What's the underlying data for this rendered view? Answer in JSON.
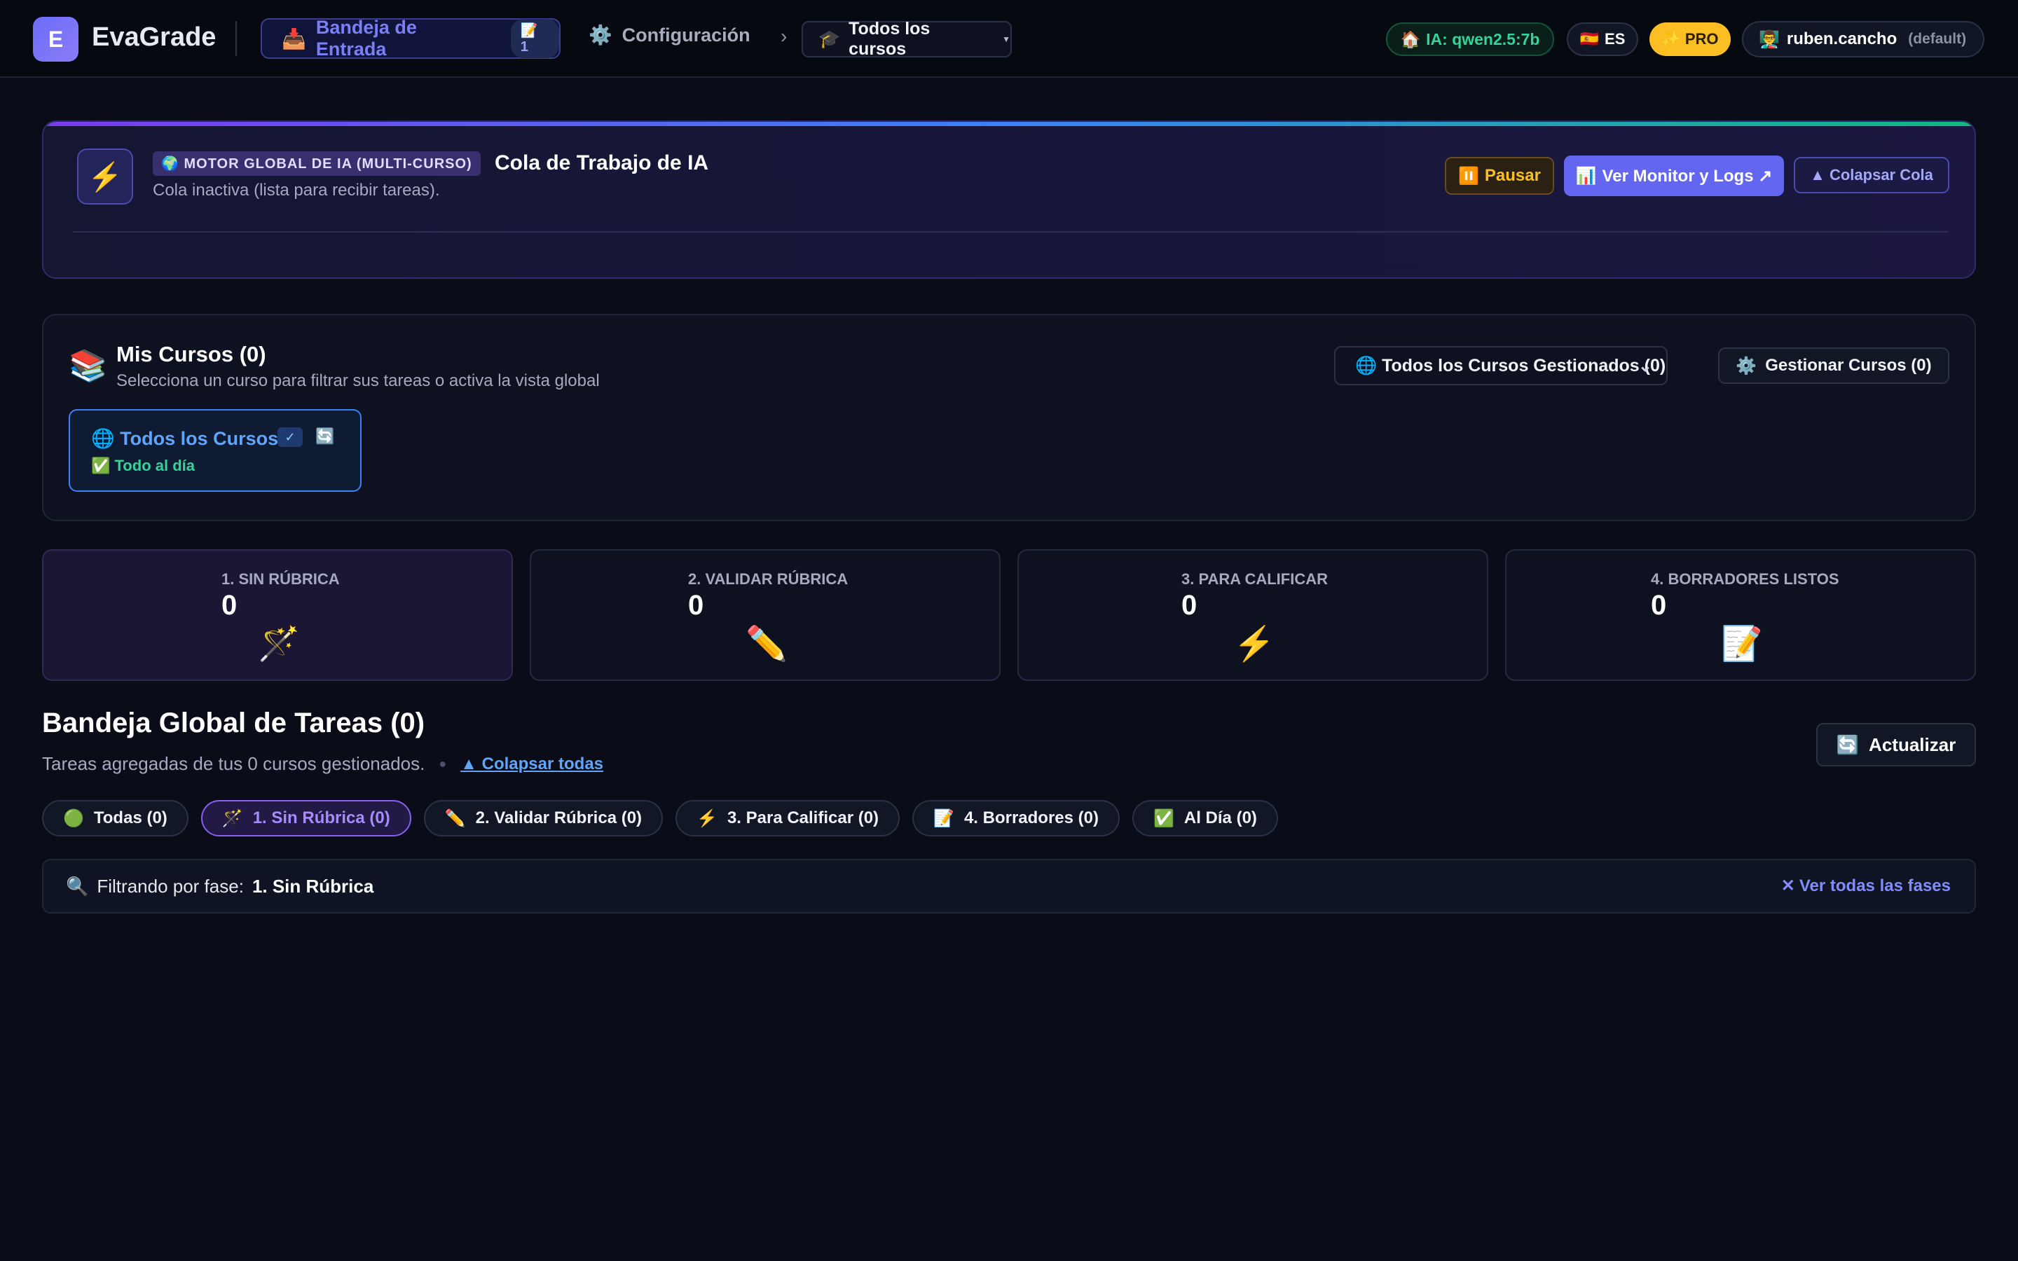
{
  "header": {
    "logo_letter": "E",
    "app_name": "EvaGrade",
    "inbox_label": "Bandeja de Entrada",
    "inbox_badge": "📝 1",
    "config_label": "Configuración",
    "course_dropdown": "Todos los cursos",
    "ai_status": "IA: qwen2.5:7b",
    "language": "ES",
    "plan": "PRO",
    "user_name": "ruben.cancho",
    "user_profile": "(default)"
  },
  "queue": {
    "engine_badge": "🌍 MOTOR GLOBAL DE IA (MULTI-CURSO)",
    "title": "Cola de Trabajo de IA",
    "subtitle": "Cola inactiva (lista para recibir tareas).",
    "pause_label": "Pausar",
    "monitor_label": "Ver Monitor y Logs ↗",
    "collapse_label": "▲ Colapsar Cola"
  },
  "courses": {
    "title": "Mis Cursos (0)",
    "subtitle": "Selecciona un curso para filtrar sus tareas o activa la vista global",
    "managed_select": "🌐 Todos los Cursos Gestionados (0)",
    "manage_label": "Gestionar Cursos (0)",
    "card_name": "🌐 Todos los Cursos",
    "card_check": "✓",
    "card_status": "✅ Todo al día"
  },
  "stats": [
    {
      "label": "1. SIN RÚBRICA",
      "value": "0",
      "emoji": "🪄"
    },
    {
      "label": "2. VALIDAR RÚBRICA",
      "value": "0",
      "emoji": "✏️"
    },
    {
      "label": "3. PARA CALIFICAR",
      "value": "0",
      "emoji": "⚡"
    },
    {
      "label": "4. BORRADORES LISTOS",
      "value": "0",
      "emoji": "📝"
    }
  ],
  "inbox": {
    "title": "Bandeja Global de Tareas (0)",
    "subtitle": "Tareas agregadas de tus 0 cursos gestionados.",
    "collapse_all": "▲ Colapsar todas",
    "refresh_label": "Actualizar"
  },
  "filters": [
    {
      "icon": "🟢",
      "label": "Todas (0)"
    },
    {
      "icon": "🪄",
      "label": "1. Sin Rúbrica (0)"
    },
    {
      "icon": "✏️",
      "label": "2. Validar Rúbrica (0)"
    },
    {
      "icon": "⚡",
      "label": "3. Para Calificar (0)"
    },
    {
      "icon": "📝",
      "label": "4. Borradores (0)"
    },
    {
      "icon": "✅",
      "label": "Al Día (0)"
    }
  ],
  "filter_bar": {
    "prefix": "Filtrando por fase:",
    "phase": "1. Sin Rúbrica",
    "clear_label": "Ver todas las fases"
  },
  "colors": {
    "accent": "#6366f1",
    "success": "#34d399",
    "warning": "#fbbf24",
    "link": "#60a5fa"
  }
}
